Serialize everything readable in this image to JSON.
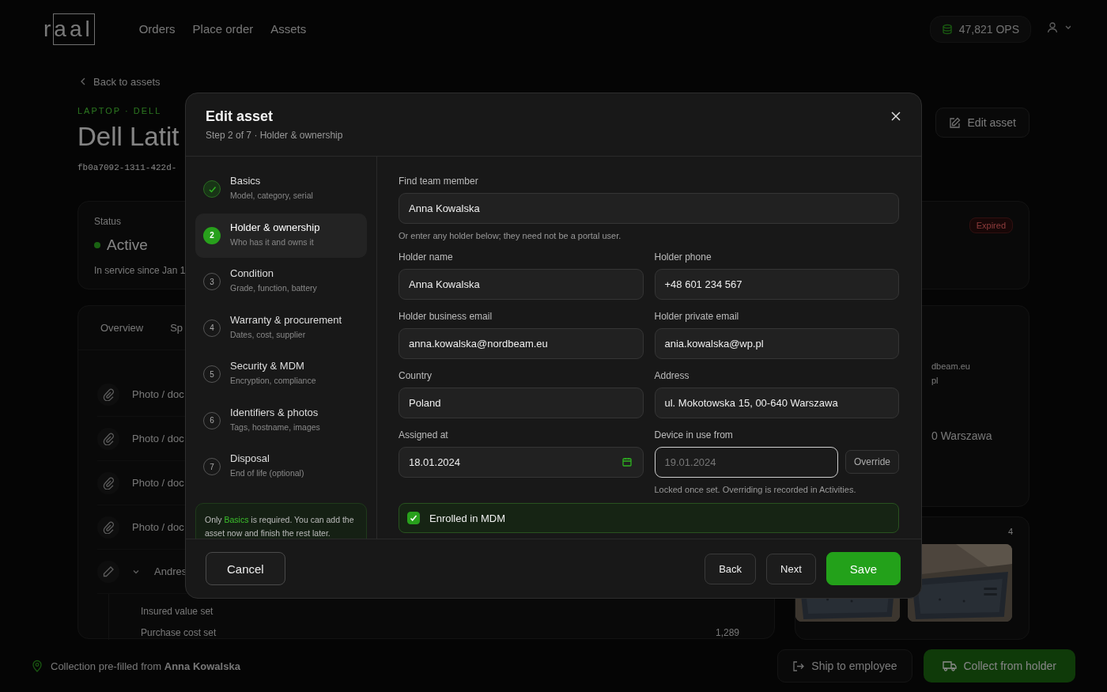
{
  "header": {
    "logo": "raal",
    "nav": [
      "Orders",
      "Place order",
      "Assets"
    ],
    "balance": "47,821 OPS"
  },
  "page": {
    "back": "Back to assets",
    "category": "LAPTOP · DELL",
    "title": "Dell Latit",
    "uuid": "fb0a7092-1311-422d-",
    "edit_button": "Edit asset",
    "status": {
      "label": "Status",
      "value": "Active",
      "since": "In service since Jan 1"
    },
    "badge": "Expired",
    "tabs": [
      "Overview",
      "Sp"
    ],
    "rows": [
      {
        "kind": "attachment",
        "label": "Photo / doc"
      },
      {
        "kind": "attachment",
        "label": "Photo / doc"
      },
      {
        "kind": "attachment",
        "label": "Photo / doc"
      },
      {
        "kind": "attachment",
        "label": "Photo / doc"
      },
      {
        "kind": "edit",
        "label": "Andres"
      }
    ],
    "details": [
      {
        "label": "Insured value set"
      },
      {
        "label": "Purchase cost set",
        "value": "1,289"
      }
    ],
    "holder_side": [
      "dbeam.eu",
      "pl",
      "0 Warszawa"
    ],
    "photos": {
      "count": "4"
    }
  },
  "bottom_bar": {
    "note": "Collection pre-filled from **Anna Kowalska**",
    "buttons": [
      "Ship to employee",
      "Collect from holder"
    ]
  },
  "modal": {
    "title": "Edit asset",
    "subtitle": "Step 2 of 7 · Holder & ownership",
    "steps": [
      {
        "title": "Basics",
        "subtitle": "Model, category, serial",
        "done": true,
        "selected": false
      },
      {
        "number": "2",
        "title": "Holder & ownership",
        "subtitle": "Who has it and owns it",
        "done": false,
        "selected": true
      },
      {
        "number": "3",
        "title": "Condition",
        "subtitle": "Grade, function, battery",
        "done": false,
        "selected": false
      },
      {
        "number": "4",
        "title": "Warranty & procurement",
        "subtitle": "Dates, cost, supplier",
        "done": false,
        "selected": false
      },
      {
        "number": "5",
        "title": "Security & MDM",
        "subtitle": "Encryption, compliance",
        "done": false,
        "selected": false
      },
      {
        "number": "6",
        "title": "Identifiers & photos",
        "subtitle": "Tags, hostname, images",
        "done": false,
        "selected": false
      },
      {
        "number": "7",
        "title": "Disposal",
        "subtitle": "End of life (optional)",
        "done": false,
        "selected": false
      }
    ],
    "note": {
      "before": "Only ",
      "link": "Basics",
      "after": " is required. You can add the asset now and finish the rest later."
    },
    "search": {
      "label": "Find team member",
      "value": "Anna Kowalska",
      "hint": "Or enter any holder below; they need not be a portal user."
    },
    "fields": [
      {
        "kind": "text",
        "label": "Holder name",
        "value": "Anna Kowalska"
      },
      {
        "kind": "text",
        "label": "Holder phone",
        "value": "+48 601 234 567"
      },
      {
        "kind": "text",
        "label": "Holder business email",
        "value": "anna.kowalska@nordbeam.eu"
      },
      {
        "kind": "text",
        "label": "Holder private email",
        "value": "ania.kowalska@wp.pl"
      },
      {
        "kind": "text",
        "label": "Country",
        "value": "Poland"
      },
      {
        "kind": "text",
        "label": "Address",
        "value": "ul. Mokotowska 15, 00-640 Warszawa"
      },
      {
        "kind": "date",
        "label": "Assigned at",
        "value": "18.01.2024"
      },
      {
        "kind": "locked",
        "label": "Device in use from",
        "value": "19.01.2024",
        "disabled": true,
        "button": "Override",
        "hint": "Locked once set. Overriding is recorded in Activities."
      }
    ],
    "mdm": {
      "label": "Enrolled in MDM",
      "checked": true
    },
    "buttons": {
      "cancel": "Cancel",
      "back": "Back",
      "next": "Next",
      "save": "Save"
    }
  }
}
